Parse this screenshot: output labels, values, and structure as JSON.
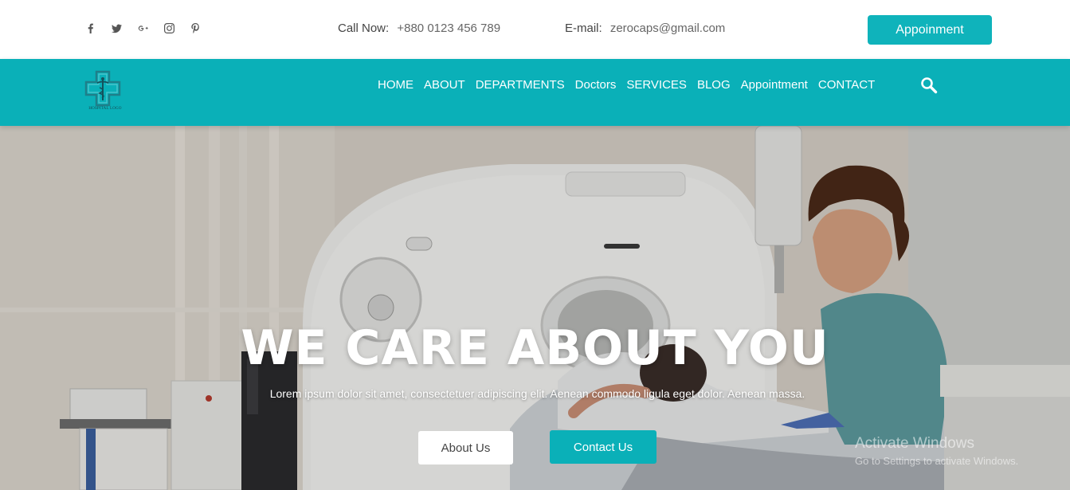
{
  "colors": {
    "accent": "#0ab0b8",
    "button": "#0fb3bb",
    "text": "#444444"
  },
  "topbar": {
    "social_icons": [
      "facebook-icon",
      "twitter-icon",
      "google-plus-icon",
      "instagram-icon",
      "pinterest-icon"
    ],
    "call_label": "Call Now:",
    "call_value": "+880 0123 456 789",
    "email_label": "E-mail:",
    "email_value": "zerocaps@gmail.com",
    "appointment_button": "Appoinment"
  },
  "navbar": {
    "logo_text": "HOSPITAL LOGO",
    "menu": [
      "HOME",
      "ABOUT",
      "DEPARTMENTS",
      "Doctors",
      "SERVICES",
      "BLOG",
      "Appointment",
      "CONTACT"
    ],
    "search_icon": "search-icon"
  },
  "hero": {
    "title": "WE CARE ABOUT YOU",
    "subtitle": "Lorem ipsum dolor sit amet, consectetuer adipiscing elit. Aenean commodo ligula eget dolor. Aenean massa.",
    "about_button": "About Us",
    "contact_button": "Contact Us"
  },
  "watermark": {
    "line1": "Activate Windows",
    "line2": "Go to Settings to activate Windows."
  }
}
